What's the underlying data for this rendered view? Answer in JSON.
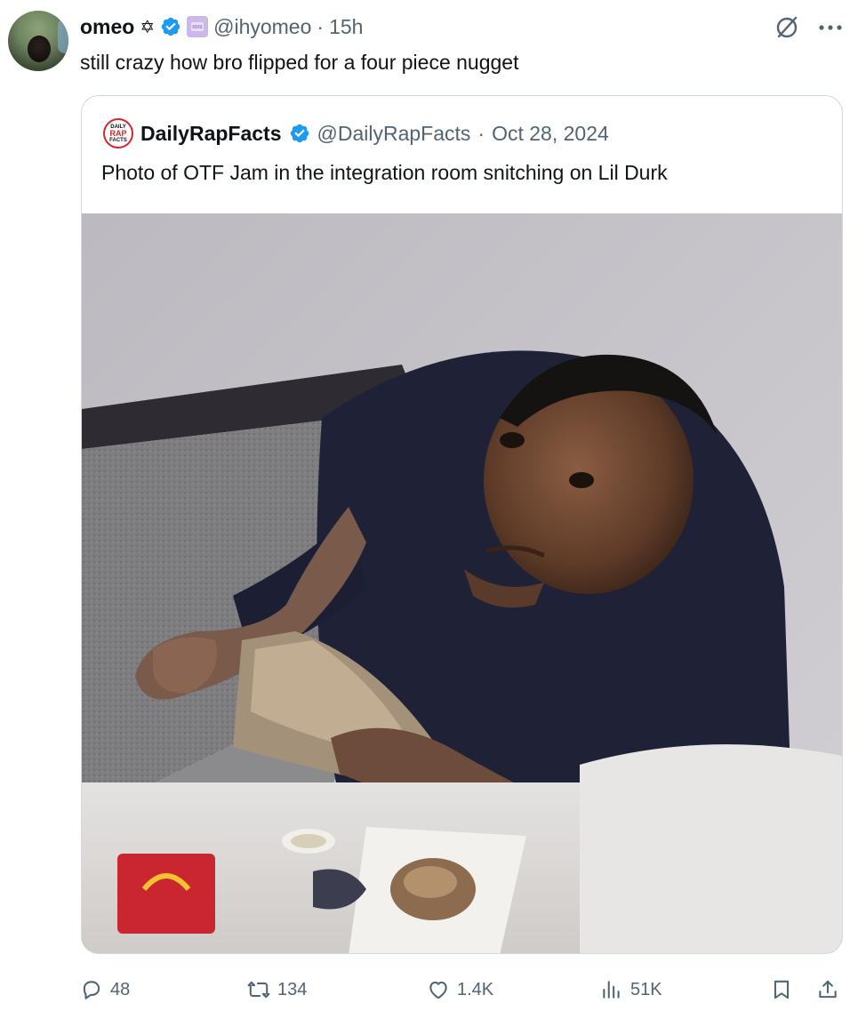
{
  "tweet": {
    "author": {
      "display_name": "omeo",
      "name_emoji": "✡",
      "handle": "@ihyomeo",
      "separator": "·",
      "time_ago": "15h",
      "avatar_icon": "hooded-person-avatar",
      "verified_badge": "verified-badge-icon",
      "affiliation_badge": "affiliate-badge-icon"
    },
    "text": "still crazy how bro flipped for a four piece nugget",
    "grok_icon": "grok-icon",
    "more_icon": "more-options-icon"
  },
  "quoted_tweet": {
    "author": {
      "display_name": "DailyRapFacts",
      "handle": "@DailyRapFacts",
      "separator": "·",
      "date": "Oct 28, 2024",
      "avatar_logo_lines": [
        "DAILY",
        "RAP",
        "FACTS"
      ]
    },
    "text": "Photo of OTF Jam in the integration room snitching on Lil Durk",
    "media_alt": "photo"
  },
  "actions": {
    "replies": {
      "icon": "reply-icon",
      "count": "48"
    },
    "reposts": {
      "icon": "repost-icon",
      "count": "134"
    },
    "likes": {
      "icon": "like-icon",
      "count": "1.4K"
    },
    "views": {
      "icon": "views-icon",
      "count": "51K"
    },
    "bookmark": {
      "icon": "bookmark-icon"
    },
    "share": {
      "icon": "share-icon"
    }
  },
  "colors": {
    "text_primary": "#0f1419",
    "text_secondary": "#536471",
    "verified_blue": "#1d9bf0",
    "border": "#cfd9de"
  }
}
